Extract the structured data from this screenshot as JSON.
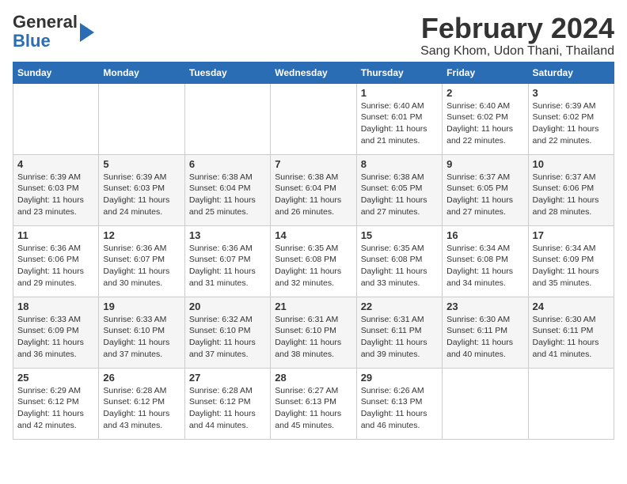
{
  "header": {
    "logo_general": "General",
    "logo_blue": "Blue",
    "title": "February 2024",
    "subtitle": "Sang Khom, Udon Thani, Thailand"
  },
  "calendar": {
    "days_of_week": [
      "Sunday",
      "Monday",
      "Tuesday",
      "Wednesday",
      "Thursday",
      "Friday",
      "Saturday"
    ],
    "weeks": [
      [
        {
          "day": "",
          "info": ""
        },
        {
          "day": "",
          "info": ""
        },
        {
          "day": "",
          "info": ""
        },
        {
          "day": "",
          "info": ""
        },
        {
          "day": "1",
          "info": "Sunrise: 6:40 AM\nSunset: 6:01 PM\nDaylight: 11 hours and 21 minutes."
        },
        {
          "day": "2",
          "info": "Sunrise: 6:40 AM\nSunset: 6:02 PM\nDaylight: 11 hours and 22 minutes."
        },
        {
          "day": "3",
          "info": "Sunrise: 6:39 AM\nSunset: 6:02 PM\nDaylight: 11 hours and 22 minutes."
        }
      ],
      [
        {
          "day": "4",
          "info": "Sunrise: 6:39 AM\nSunset: 6:03 PM\nDaylight: 11 hours and 23 minutes."
        },
        {
          "day": "5",
          "info": "Sunrise: 6:39 AM\nSunset: 6:03 PM\nDaylight: 11 hours and 24 minutes."
        },
        {
          "day": "6",
          "info": "Sunrise: 6:38 AM\nSunset: 6:04 PM\nDaylight: 11 hours and 25 minutes."
        },
        {
          "day": "7",
          "info": "Sunrise: 6:38 AM\nSunset: 6:04 PM\nDaylight: 11 hours and 26 minutes."
        },
        {
          "day": "8",
          "info": "Sunrise: 6:38 AM\nSunset: 6:05 PM\nDaylight: 11 hours and 27 minutes."
        },
        {
          "day": "9",
          "info": "Sunrise: 6:37 AM\nSunset: 6:05 PM\nDaylight: 11 hours and 27 minutes."
        },
        {
          "day": "10",
          "info": "Sunrise: 6:37 AM\nSunset: 6:06 PM\nDaylight: 11 hours and 28 minutes."
        }
      ],
      [
        {
          "day": "11",
          "info": "Sunrise: 6:36 AM\nSunset: 6:06 PM\nDaylight: 11 hours and 29 minutes."
        },
        {
          "day": "12",
          "info": "Sunrise: 6:36 AM\nSunset: 6:07 PM\nDaylight: 11 hours and 30 minutes."
        },
        {
          "day": "13",
          "info": "Sunrise: 6:36 AM\nSunset: 6:07 PM\nDaylight: 11 hours and 31 minutes."
        },
        {
          "day": "14",
          "info": "Sunrise: 6:35 AM\nSunset: 6:08 PM\nDaylight: 11 hours and 32 minutes."
        },
        {
          "day": "15",
          "info": "Sunrise: 6:35 AM\nSunset: 6:08 PM\nDaylight: 11 hours and 33 minutes."
        },
        {
          "day": "16",
          "info": "Sunrise: 6:34 AM\nSunset: 6:08 PM\nDaylight: 11 hours and 34 minutes."
        },
        {
          "day": "17",
          "info": "Sunrise: 6:34 AM\nSunset: 6:09 PM\nDaylight: 11 hours and 35 minutes."
        }
      ],
      [
        {
          "day": "18",
          "info": "Sunrise: 6:33 AM\nSunset: 6:09 PM\nDaylight: 11 hours and 36 minutes."
        },
        {
          "day": "19",
          "info": "Sunrise: 6:33 AM\nSunset: 6:10 PM\nDaylight: 11 hours and 37 minutes."
        },
        {
          "day": "20",
          "info": "Sunrise: 6:32 AM\nSunset: 6:10 PM\nDaylight: 11 hours and 37 minutes."
        },
        {
          "day": "21",
          "info": "Sunrise: 6:31 AM\nSunset: 6:10 PM\nDaylight: 11 hours and 38 minutes."
        },
        {
          "day": "22",
          "info": "Sunrise: 6:31 AM\nSunset: 6:11 PM\nDaylight: 11 hours and 39 minutes."
        },
        {
          "day": "23",
          "info": "Sunrise: 6:30 AM\nSunset: 6:11 PM\nDaylight: 11 hours and 40 minutes."
        },
        {
          "day": "24",
          "info": "Sunrise: 6:30 AM\nSunset: 6:11 PM\nDaylight: 11 hours and 41 minutes."
        }
      ],
      [
        {
          "day": "25",
          "info": "Sunrise: 6:29 AM\nSunset: 6:12 PM\nDaylight: 11 hours and 42 minutes."
        },
        {
          "day": "26",
          "info": "Sunrise: 6:28 AM\nSunset: 6:12 PM\nDaylight: 11 hours and 43 minutes."
        },
        {
          "day": "27",
          "info": "Sunrise: 6:28 AM\nSunset: 6:12 PM\nDaylight: 11 hours and 44 minutes."
        },
        {
          "day": "28",
          "info": "Sunrise: 6:27 AM\nSunset: 6:13 PM\nDaylight: 11 hours and 45 minutes."
        },
        {
          "day": "29",
          "info": "Sunrise: 6:26 AM\nSunset: 6:13 PM\nDaylight: 11 hours and 46 minutes."
        },
        {
          "day": "",
          "info": ""
        },
        {
          "day": "",
          "info": ""
        }
      ]
    ]
  }
}
